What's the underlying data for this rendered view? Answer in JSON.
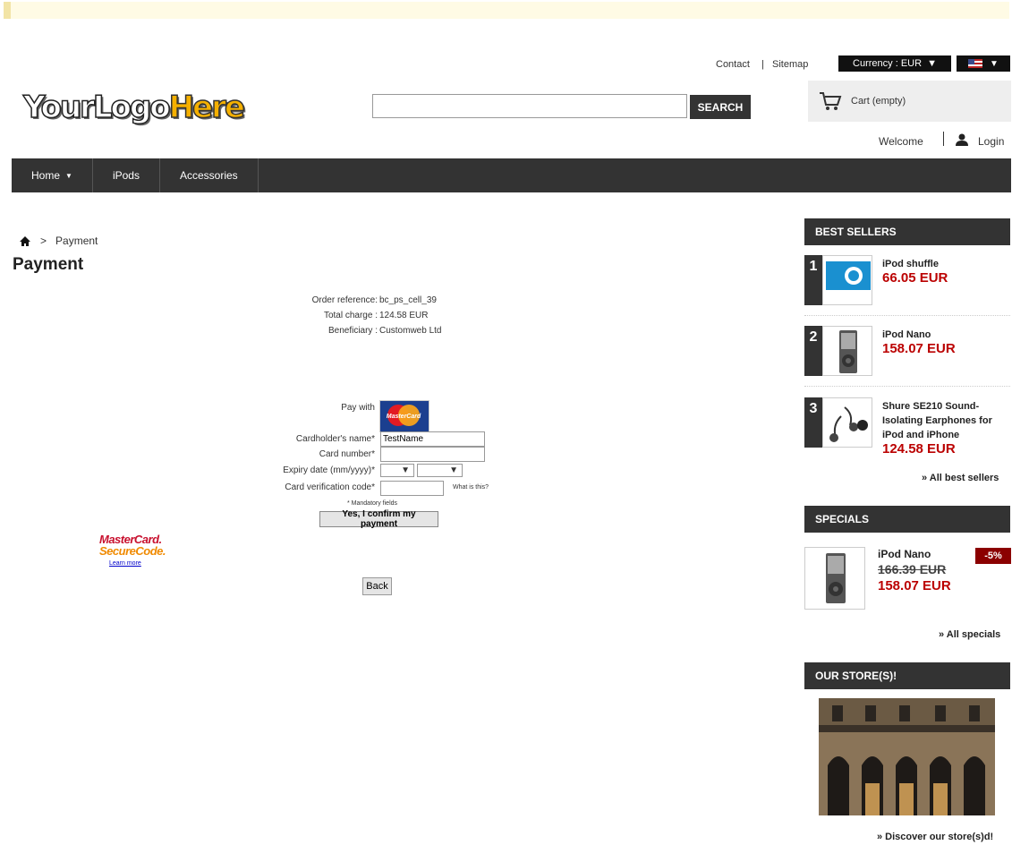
{
  "header": {
    "links": {
      "contact": "Contact",
      "sep": "|",
      "sitemap": "Sitemap"
    },
    "currency": {
      "label": "Currency : EUR",
      "caret": "▼"
    },
    "language": {
      "caret": "▼"
    },
    "logo": {
      "part1": "YourLogo",
      "part2": "Here"
    },
    "search": {
      "value": "",
      "button": "SEARCH"
    },
    "cart": {
      "label": "Cart (empty)"
    },
    "welcome": "Welcome",
    "login": "Login"
  },
  "nav": {
    "items": [
      {
        "label": "Home",
        "caret": "▼"
      },
      {
        "label": "iPods"
      },
      {
        "label": "Accessories"
      }
    ]
  },
  "breadcrumb": {
    "sep": ">",
    "current": "Payment"
  },
  "page_title": "Payment",
  "order_info": {
    "ref_label": "Order reference:",
    "ref_value": "bc_ps_cell_39",
    "total_label": "Total charge :",
    "total_value": "124.58 EUR",
    "benef_label": "Beneficiary :",
    "benef_value": "Customweb Ltd"
  },
  "payment_form": {
    "pay_with": "Pay with",
    "card_logo": "MasterCard",
    "cardholder_label": "Cardholder's name*",
    "cardholder_value": "TestName",
    "card_number_label": "Card number*",
    "card_number_value": "",
    "expiry_label": "Expiry date (mm/yyyy)*",
    "expiry_caret": "▼",
    "cvc_label": "Card verification code*",
    "cvc_value": "",
    "whats_this": "What is this?",
    "mandatory_note": "* Mandatory fields",
    "confirm_button": "Yes, I confirm my payment",
    "secure_l1": "MasterCard.",
    "secure_l2": "SecureCode.",
    "learn_more": "Learn more",
    "back_button": "Back"
  },
  "best_sellers": {
    "title": "BEST SELLERS",
    "items": [
      {
        "rank": "1",
        "name": "iPod shuffle",
        "price": "66.05 EUR"
      },
      {
        "rank": "2",
        "name": "iPod Nano",
        "price": "158.07 EUR"
      },
      {
        "rank": "3",
        "name": "Shure SE210 Sound-Isolating Earphones for iPod and iPhone",
        "price": "124.58 EUR"
      }
    ],
    "more": "» All best sellers"
  },
  "specials": {
    "title": "SPECIALS",
    "item": {
      "name": "iPod Nano",
      "old_price": "166.39 EUR",
      "price": "158.07 EUR",
      "badge": "-5%"
    },
    "more": "» All specials"
  },
  "stores": {
    "title": "OUR STORE(S)!",
    "more": "» Discover our store(s)d!"
  },
  "colors": {
    "dark": "#333333",
    "price_red": "#bb0000",
    "badge_red": "#8b0000",
    "notice": "#fffbe5"
  }
}
